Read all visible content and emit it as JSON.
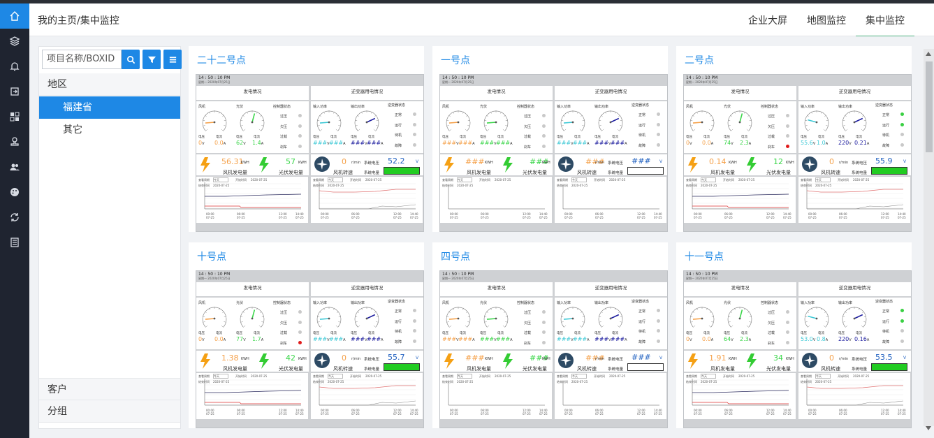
{
  "header": {
    "breadcrumb": "我的主页/集中监控",
    "tabs": [
      {
        "label": "企业大屏",
        "active": false
      },
      {
        "label": "地图监控",
        "active": false
      },
      {
        "label": "集中监控",
        "active": true
      }
    ]
  },
  "rail": {
    "icons": [
      "home-icon",
      "layers-icon",
      "bell-icon",
      "export-icon",
      "dashboard-grid-icon",
      "stamp-icon",
      "users-icon",
      "palette-icon",
      "refresh-cycle-icon",
      "list-icon"
    ]
  },
  "left_panel": {
    "search_placeholder": "项目名称/BOXID",
    "buttons": [
      "search-icon",
      "filter-icon",
      "menu-icon"
    ],
    "region_label": "地区",
    "region_items": [
      {
        "label": "福建省",
        "selected": true
      },
      {
        "label": "其它",
        "selected": false
      }
    ],
    "customer_label": "客户",
    "group_label": "分组"
  },
  "colors": {
    "accent": "#1e88e5",
    "green_tab": "#4cb07f",
    "orange": "#f5a14a",
    "green": "#3bd64a",
    "cyan": "#3ec9d6",
    "navy": "#2020a0",
    "red_dot": "#e01b1b",
    "green_dot": "#3ad043"
  },
  "monitor_labels": {
    "time": "14 : 50 : 10  PM",
    "sub_time": "星期一 2020年07月25日",
    "gen_title": "发电情况",
    "inv_title": "逆变器用电情况",
    "wind": "风机",
    "solar": "光伏",
    "in_power": "输入功率",
    "out_power": "输出功率",
    "voltage": "电压",
    "current": "电流",
    "ctrl_state": "控制器状态",
    "inv_state": "逆变器状态",
    "ctrl_items": [
      "过压",
      "欠压",
      "过载",
      "刹车"
    ],
    "inv_items": [
      "正常",
      "运行",
      "待机",
      "故障"
    ],
    "wind_gen": "风机发电量",
    "solar_gen": "光伏发电量",
    "wind_speed": "风机转速",
    "sys_voltage": "系统电压",
    "sys_power": "系统电量",
    "kwh": "KWH",
    "rpm_unit": "r/min",
    "v_unit": "V",
    "a_unit": "A",
    "q_period": "查看周期",
    "q_period_val": "今天",
    "q_start": "开始时间",
    "q_date": "2020-07-25",
    "q_end": "结束时间",
    "x_ticks": [
      "00:00",
      "06:00",
      "12:00",
      "14:40"
    ],
    "x_ticks_sub": "07-25",
    "na": "###"
  },
  "cards": [
    {
      "title": "二十二号点",
      "wv": "0",
      "wa": "0.0",
      "sv": "62",
      "sa": "1.4",
      "iv": "###",
      "ia": "###",
      "ov": "###",
      "oa": "###",
      "ctrl_dots": [
        "gray",
        "gray",
        "gray",
        "gray"
      ],
      "inv_dots": [
        "gray",
        "gray",
        "gray",
        "gray"
      ],
      "wind_kwh": "56.31",
      "solar_kwh": "57",
      "rpm": "0",
      "sys_v": "52.2",
      "has_data": true
    },
    {
      "title": "一号点",
      "wv": "###",
      "wa": "###",
      "sv": "###",
      "sa": "###",
      "iv": "###",
      "ia": "###",
      "ov": "###",
      "oa": "###",
      "ctrl_dots": [
        "gray",
        "gray",
        "gray",
        "gray"
      ],
      "inv_dots": [
        "gray",
        "gray",
        "gray",
        "gray"
      ],
      "wind_kwh": "###",
      "solar_kwh": "###",
      "rpm": "###",
      "sys_v": "###",
      "has_data": false
    },
    {
      "title": "二号点",
      "wv": "0",
      "wa": "0.0",
      "sv": "74",
      "sa": "2.3",
      "iv": "55.6",
      "ia": "1.0",
      "ov": "220",
      "oa": "0.21",
      "ctrl_dots": [
        "gray",
        "gray",
        "gray",
        "red"
      ],
      "inv_dots": [
        "green",
        "green",
        "gray",
        "gray"
      ],
      "wind_kwh": "0.14",
      "solar_kwh": "12",
      "rpm": "0",
      "sys_v": "55.9",
      "has_data": true
    },
    {
      "title": "十号点",
      "wv": "0",
      "wa": "0.0",
      "sv": "77",
      "sa": "1.7",
      "iv": "###",
      "ia": "###",
      "ov": "###",
      "oa": "###",
      "ctrl_dots": [
        "gray",
        "gray",
        "gray",
        "red"
      ],
      "inv_dots": [
        "gray",
        "gray",
        "gray",
        "gray"
      ],
      "wind_kwh": "1.38",
      "solar_kwh": "42",
      "rpm": "0",
      "sys_v": "55.7",
      "has_data": true
    },
    {
      "title": "四号点",
      "wv": "###",
      "wa": "###",
      "sv": "###",
      "sa": "###",
      "iv": "###",
      "ia": "###",
      "ov": "###",
      "oa": "###",
      "ctrl_dots": [
        "gray",
        "gray",
        "gray",
        "gray"
      ],
      "inv_dots": [
        "gray",
        "gray",
        "gray",
        "gray"
      ],
      "wind_kwh": "###",
      "solar_kwh": "###",
      "rpm": "###",
      "sys_v": "###",
      "has_data": false
    },
    {
      "title": "十一号点",
      "wv": "0",
      "wa": "0.0",
      "sv": "64",
      "sa": "2.3",
      "iv": "53.0",
      "ia": "0.8",
      "ov": "220",
      "oa": "0.16",
      "ctrl_dots": [
        "gray",
        "gray",
        "gray",
        "gray"
      ],
      "inv_dots": [
        "green",
        "green",
        "gray",
        "gray"
      ],
      "wind_kwh": "1.91",
      "solar_kwh": "34",
      "rpm": "0",
      "sys_v": "53.5",
      "has_data": true
    }
  ]
}
